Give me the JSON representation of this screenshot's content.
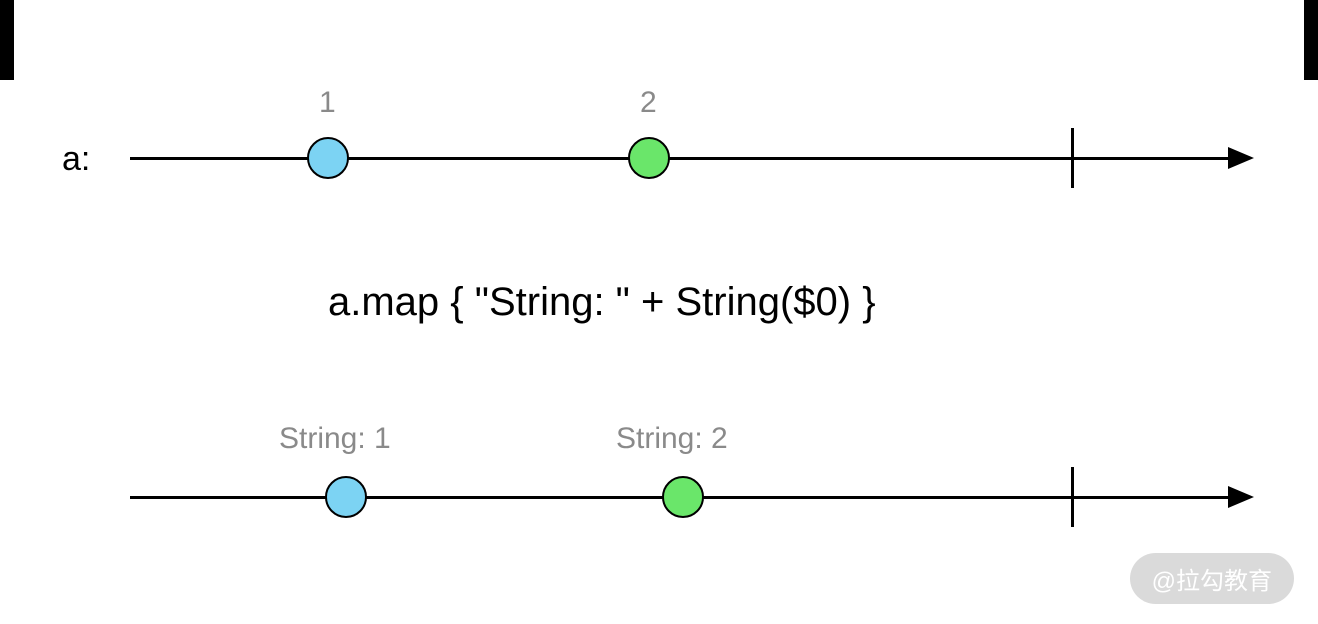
{
  "stream_label": "a:",
  "input": {
    "marbles": [
      {
        "label": "1",
        "color": "blue"
      },
      {
        "label": "2",
        "color": "green"
      }
    ]
  },
  "operator": "a.map { \"String: \" + String($0) }",
  "output": {
    "marbles": [
      {
        "label": "String: 1",
        "color": "blue"
      },
      {
        "label": "String: 2",
        "color": "green"
      }
    ]
  },
  "watermark": "@拉勾教育",
  "chart_data": {
    "type": "marble-diagram",
    "input_stream": {
      "name": "a",
      "events": [
        1,
        2
      ],
      "completed": true
    },
    "transformation": "map { \"String: \" + String($0) }",
    "output_stream": {
      "events": [
        "String: 1",
        "String: 2"
      ],
      "completed": true
    }
  }
}
